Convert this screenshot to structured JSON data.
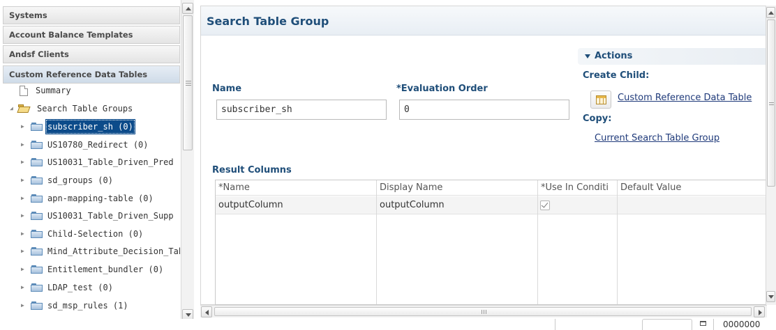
{
  "navigator": {
    "accordion": [
      {
        "label": "Systems"
      },
      {
        "label": "Account Balance Templates"
      },
      {
        "label": "Andsf Clients"
      },
      {
        "label": "Custom Reference Data Tables"
      }
    ],
    "tree": {
      "summary": "Summary",
      "group": "Search Table Groups",
      "items": [
        {
          "label": "subscriber_sh (0)",
          "selected": true
        },
        {
          "label": "US10780_Redirect (0)"
        },
        {
          "label": "US10031_Table_Driven_Pred"
        },
        {
          "label": "sd_groups (0)"
        },
        {
          "label": "apn-mapping-table (0)"
        },
        {
          "label": "US10031_Table_Driven_Supp"
        },
        {
          "label": "Child-Selection (0)"
        },
        {
          "label": "Mind_Attribute_Decision_Tabl"
        },
        {
          "label": "Entitlement_bundler (0)"
        },
        {
          "label": "LDAP_test (0)"
        },
        {
          "label": "sd_msp_rules (1)"
        }
      ]
    }
  },
  "editor": {
    "title": "Search Table Group",
    "name_label": "Name",
    "name_value": "subscriber_sh",
    "eval_label": "*Evaluation Order",
    "eval_value": "0",
    "actions": {
      "title": "Actions",
      "create_child": "Create Child:",
      "create_link": "Custom Reference Data Table",
      "copy": "Copy:",
      "copy_link": "Current Search Table Group"
    },
    "result_columns": {
      "label": "Result Columns",
      "headers": [
        "*Name",
        "Display Name",
        "*Use In Conditi",
        "Default Value"
      ],
      "rows": [
        {
          "name": "outputColumn",
          "display": "outputColumn",
          "use_in_condition": true,
          "default": ""
        }
      ]
    }
  },
  "statusbar": {
    "text": "0000000"
  },
  "colors": {
    "title_blue": "#1f4e79",
    "selection": "#0c4b8a"
  }
}
